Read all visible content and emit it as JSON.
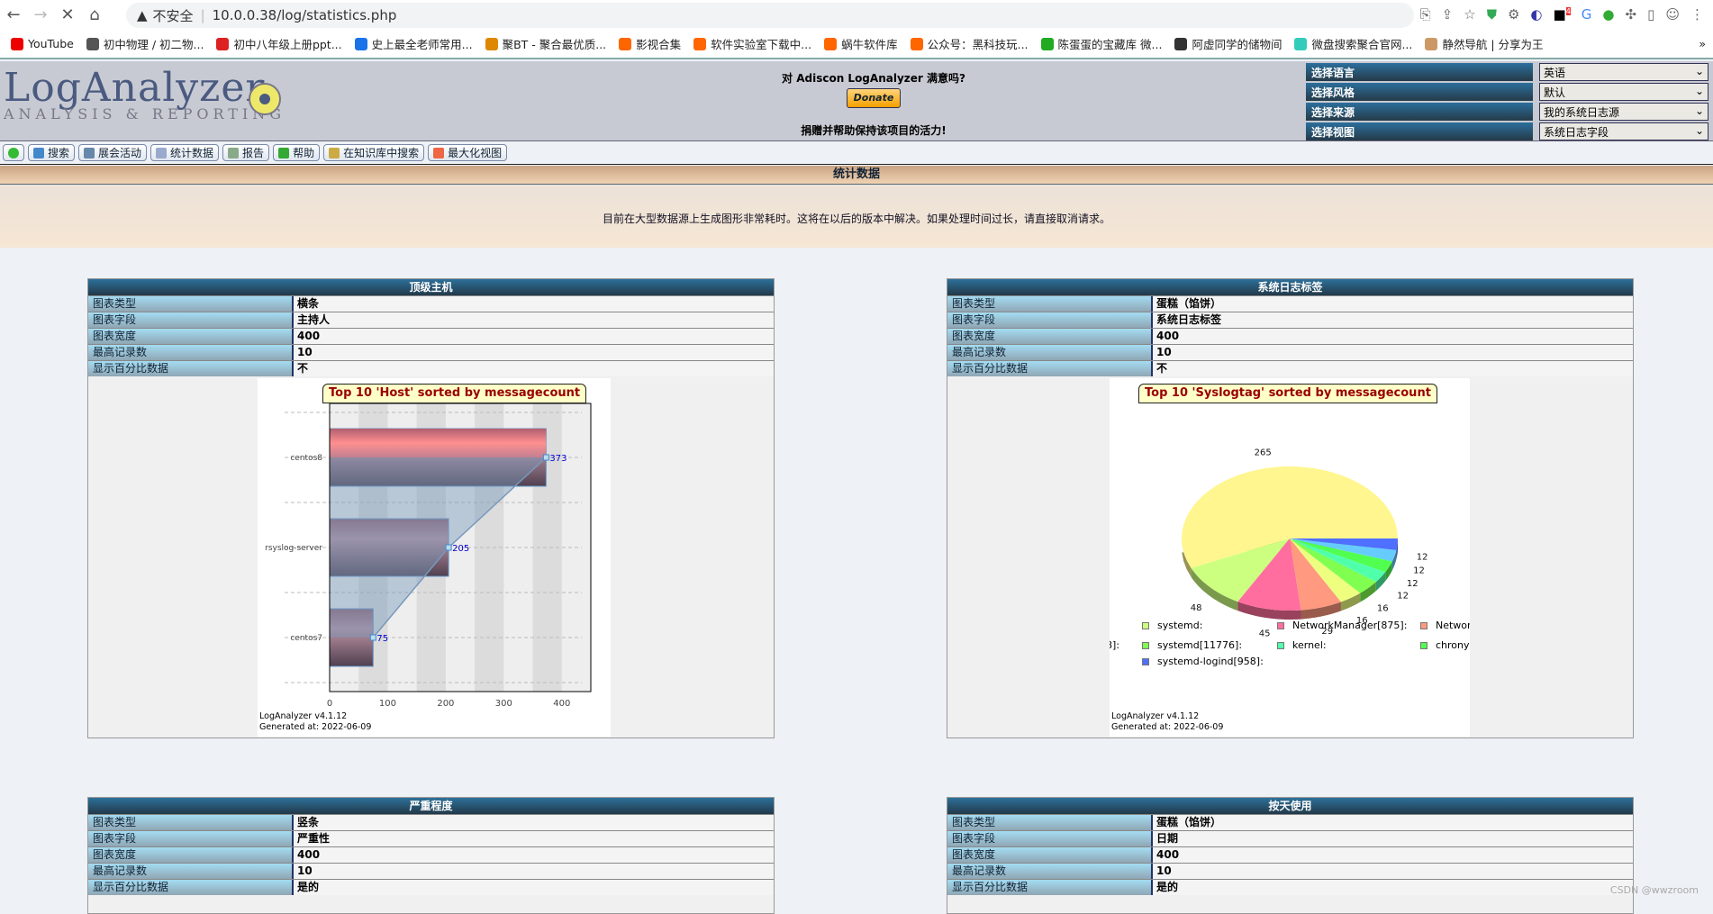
{
  "browser": {
    "url": "10.0.0.38/log/statistics.php",
    "security": "不安全",
    "badge": "4",
    "bookmarks": [
      {
        "label": "YouTube",
        "color": "#e00"
      },
      {
        "label": "初中物理 / 初二物...",
        "color": "#555"
      },
      {
        "label": "初中八年级上册ppt...",
        "color": "#d22"
      },
      {
        "label": "史上最全老师常用...",
        "color": "#1a73e8"
      },
      {
        "label": "聚BT - 聚合最优质...",
        "color": "#d80"
      },
      {
        "label": "影视合集",
        "color": "#f60"
      },
      {
        "label": "软件实验室下载中...",
        "color": "#f60"
      },
      {
        "label": "蜗牛软件库",
        "color": "#f60"
      },
      {
        "label": "公众号：黑科技玩...",
        "color": "#f60"
      },
      {
        "label": "陈蛋蛋的宝藏库 微...",
        "color": "#2a2"
      },
      {
        "label": "阿虚同学的储物间",
        "color": "#333"
      },
      {
        "label": "微盘搜索聚合官网...",
        "color": "#3cb"
      },
      {
        "label": "静然导航 | 分享为王",
        "color": "#c96"
      }
    ]
  },
  "header": {
    "logo_text": "LogAnalyzer",
    "logo_sub": "ANALYSIS & REPORTING",
    "donate_q": "对 Adiscon LogAnalyzer 满意吗?",
    "donate_btn": "Donate",
    "donate_note": "捐赠并帮助保持该项目的活力!",
    "selectors": [
      {
        "label": "选择语言",
        "value": "英语"
      },
      {
        "label": "选择风格",
        "value": "默认"
      },
      {
        "label": "选择来源",
        "value": "我的系统日志源"
      },
      {
        "label": "选择视图",
        "value": "系统日志字段"
      }
    ]
  },
  "toolbar": [
    {
      "label": "",
      "icon": "green-dot-icon",
      "color": "#3b3"
    },
    {
      "label": "搜索",
      "icon": "search-icon",
      "color": "#48c"
    },
    {
      "label": "展会活动",
      "icon": "home-icon",
      "color": "#68a"
    },
    {
      "label": "统计数据",
      "icon": "chart-icon",
      "color": "#9ac"
    },
    {
      "label": "报告",
      "icon": "report-icon",
      "color": "#8a8"
    },
    {
      "label": "帮助",
      "icon": "help-icon",
      "color": "#3a3"
    },
    {
      "label": "在知识库中搜索",
      "icon": "books-icon",
      "color": "#ca4"
    },
    {
      "label": "最大化视图",
      "icon": "maximize-icon",
      "color": "#e64"
    }
  ],
  "page_title": "统计数据",
  "notice": "目前在大型数据源上生成图形非常耗时。这将在以后的版本中解决。如果处理时间过长，请直接取消请求。",
  "row_labels": [
    "图表类型",
    "图表字段",
    "图表宽度",
    "最高记录数",
    "显示百分比数据"
  ],
  "panels": [
    {
      "title": "顶级主机",
      "values": [
        "横条",
        "主持人",
        "400",
        "10",
        "不"
      ]
    },
    {
      "title": "系统日志标签",
      "values": [
        "蛋糕（馅饼）",
        "系统日志标签",
        "400",
        "10",
        "不"
      ]
    },
    {
      "title": "严重程度",
      "values": [
        "竖条",
        "严重性",
        "400",
        "10",
        "是的"
      ]
    },
    {
      "title": "按天使用",
      "values": [
        "蛋糕（馅饼）",
        "日期",
        "400",
        "10",
        "是的"
      ]
    }
  ],
  "chart_footer": {
    "version": "LogAnalyzer v4.1.12",
    "generated": "Generated at: 2022-06-09"
  },
  "chart_data": [
    {
      "type": "bar",
      "orientation": "horizontal",
      "title": "Top 10 'Host' sorted by messagecount",
      "categories": [
        "centos8",
        "rsyslog-server",
        "centos7"
      ],
      "values": [
        373,
        205,
        75
      ],
      "xticks": [
        0,
        100,
        200,
        300,
        400
      ],
      "xlim": [
        0,
        450
      ],
      "bar_color": "#b08090",
      "line_color": "#7799bb"
    },
    {
      "type": "pie",
      "title": "Top 10 'Syslogtag' sorted by messagecount",
      "values": [
        265,
        48,
        45,
        29,
        16,
        16,
        12,
        12,
        12,
        12
      ],
      "colors": [
        "#fff68f",
        "#ccff80",
        "#ff6e9e",
        "#ff9980",
        "#eeff80",
        "#80ff50",
        "#50ffaa",
        "#50ff50",
        "#66ccff",
        "#4f6fff"
      ],
      "legend": [
        {
          "label": "systemd:",
          "color": "#ccff80"
        },
        {
          "label": "NetworkManager[875]:",
          "color": "#ff6e9e"
        },
        {
          "label": "Networ",
          "color": "#ff9980"
        },
        {
          "label": "8]:",
          "color": ""
        },
        {
          "label": "systemd[11776]:",
          "color": "#80ff50"
        },
        {
          "label": "kernel:",
          "color": "#50ffaa"
        },
        {
          "label": "chrony",
          "color": "#50ff50"
        },
        {
          "label": "systemd-logind[958]:",
          "color": "#4f6fff"
        }
      ]
    }
  ],
  "watermark": "CSDN @wwzroom"
}
